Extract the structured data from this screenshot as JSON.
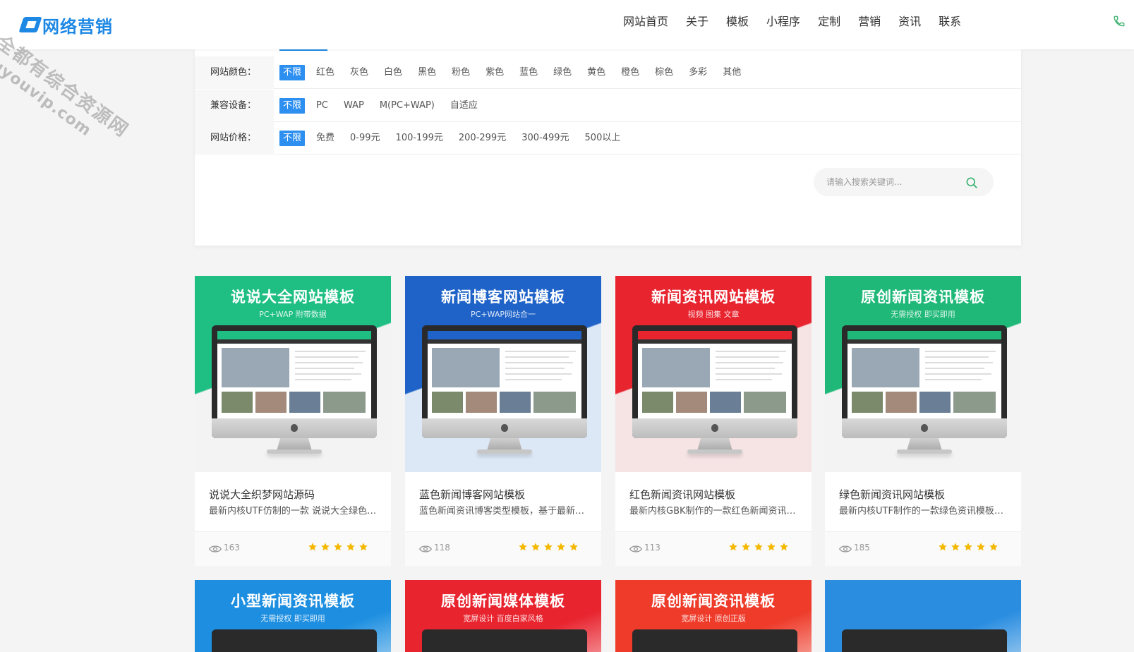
{
  "header": {
    "logo_text": "网络营销",
    "watermark_line1": "全都有综合资源网",
    "watermark_line2": "douyouvip.com",
    "nav": [
      "网站首页",
      "关于",
      "模板",
      "小程序",
      "定制",
      "营销",
      "资讯",
      "联系"
    ]
  },
  "filters": [
    {
      "label": "网站颜色：",
      "options": [
        "不限",
        "红色",
        "灰色",
        "白色",
        "黑色",
        "粉色",
        "紫色",
        "蓝色",
        "绿色",
        "黄色",
        "橙色",
        "棕色",
        "多彩",
        "其他"
      ]
    },
    {
      "label": "兼容设备：",
      "options": [
        "不限",
        "PC",
        "WAP",
        "M(PC+WAP)",
        "自适应"
      ]
    },
    {
      "label": "网站价格：",
      "options": [
        "不限",
        "免费",
        "0-99元",
        "100-199元",
        "200-299元",
        "300-499元",
        "500以上"
      ]
    }
  ],
  "search": {
    "placeholder": "请输入搜索关键词..."
  },
  "cards": [
    {
      "thumb_title": "说说大全网站模板",
      "thumb_sub": "PC+WAP 附带数据",
      "name": "说说大全织梦网站源码",
      "desc": "最新内核UTF仿制的一款 说说大全绿色网站模板",
      "views": "163",
      "rating": 5,
      "color_top": "#1fbf84",
      "color_bottom": "#f3f3f3"
    },
    {
      "thumb_title": "新闻博客网站模板",
      "thumb_sub": "PC+WAP网站合一",
      "name": "蓝色新闻博客网站模板",
      "desc": "蓝色新闻资讯博客类型模板，基于最新内核制作",
      "views": "118",
      "rating": 5,
      "color_top": "#1f63c8",
      "color_bottom": "#dde8f6"
    },
    {
      "thumb_title": "新闻资讯网站模板",
      "thumb_sub": "视频 图集 文章",
      "name": "红色新闻资讯网站模板",
      "desc": "最新内核GBK制作的一款红色新闻资讯网站模板",
      "views": "113",
      "rating": 5,
      "color_top": "#e8242f",
      "color_bottom": "#f6e4e5"
    },
    {
      "thumb_title": "原创新闻资讯模板",
      "thumb_sub": "无需授权 即买即用",
      "name": "绿色新闻资讯网站模板",
      "desc": "最新内核UTF制作的一款绿色资讯模板网站源码",
      "views": "185",
      "rating": 5,
      "color_top": "#1fb878",
      "color_bottom": "#f3f3f3"
    }
  ],
  "cards_row2": [
    {
      "thumb_title": "小型新闻资讯模板",
      "thumb_sub": "无需授权 即买即用",
      "color": "#1e8fe0"
    },
    {
      "thumb_title": "原创新闻媒体模板",
      "thumb_sub": "宽屏设计 百度白家风格",
      "color": "#e8242f"
    },
    {
      "thumb_title": "原创新闻资讯模板",
      "thumb_sub": "宽屏设计 原创正版",
      "color": "#ee3b2a"
    },
    {
      "thumb_title": "",
      "thumb_sub": "",
      "color": "#2a8de0"
    }
  ],
  "colors": {
    "accent": "#2d8ff0",
    "phone": "#3cb371",
    "star": "#f5b800"
  }
}
